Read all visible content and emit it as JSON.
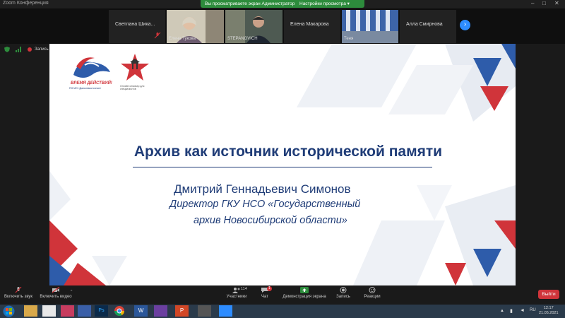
{
  "window": {
    "app_title": "Zoom Конференция",
    "banner_text": "Вы просматриваете экран Администратор",
    "banner_options": "Настройки просмотра ▾"
  },
  "participants": [
    {
      "name": "Светлана  Шика..."
    },
    {
      "name": "Елена Тукова"
    },
    {
      "name": "STEPANOVICH"
    },
    {
      "name": "Елена Макарова"
    },
    {
      "name": "Теня"
    },
    {
      "name": "Алла Смирнова"
    }
  ],
  "left_panel": {
    "label": "Запись"
  },
  "slide": {
    "logo1_line1": "ВРЕМЯ ДЕЙСТВИЙ!",
    "logo1_line2": "ПО МО «Дальневосточное»",
    "logo2_text": "Онлайн семинар для специалистов",
    "title": "Архив как источник исторической памяти",
    "speaker_name": "Дмитрий Геннадьевич Симонов",
    "position_line1": "Директор ГКУ НСО «Государственный",
    "position_line2": "архив Новосибирской области»",
    "colors": {
      "navy": "#1f3c77",
      "red": "#d0343a",
      "blue": "#2e5caa"
    }
  },
  "toolbar": {
    "mute_label": "Включить звук",
    "video_label": "Включить видео",
    "participants_label": "Участники",
    "participants_count": "114",
    "chat_label": "Чат",
    "chat_badge": "1",
    "share_label": "Демонстрация экрана",
    "record_label": "Запись",
    "reactions_label": "Реакции",
    "exit_label": "Выйти"
  },
  "taskbar": {
    "time": "12:17",
    "date": "21.05.2021"
  }
}
